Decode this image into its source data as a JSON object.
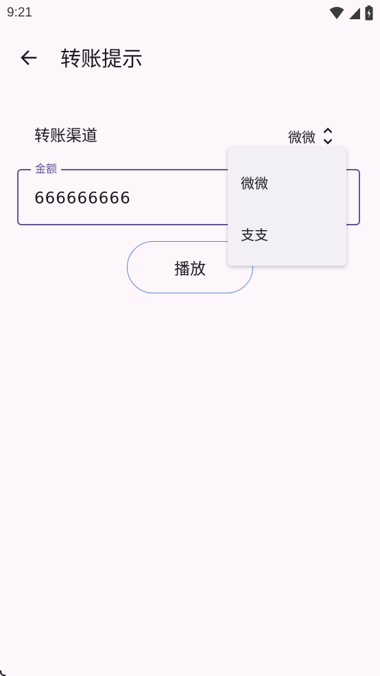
{
  "status_bar": {
    "time": "9:21",
    "icons": [
      "wifi-icon",
      "signal-icon",
      "battery-icon"
    ]
  },
  "app_bar": {
    "back_icon": "arrow-left-icon",
    "title": "转账提示"
  },
  "channel": {
    "label": "转账渠道",
    "selected": "微微",
    "arrows_icon": "unfold-icon"
  },
  "amount": {
    "label": "金额",
    "value": "666666666"
  },
  "play_button": {
    "label": "播放"
  },
  "dropdown": {
    "options": [
      "微微",
      "支支"
    ]
  },
  "colors": {
    "background": "#fdf7fc",
    "primary": "#65558f",
    "outline_button": "#5c85d6",
    "menu_surface": "#f2eff5",
    "text": "#1d1b20"
  }
}
